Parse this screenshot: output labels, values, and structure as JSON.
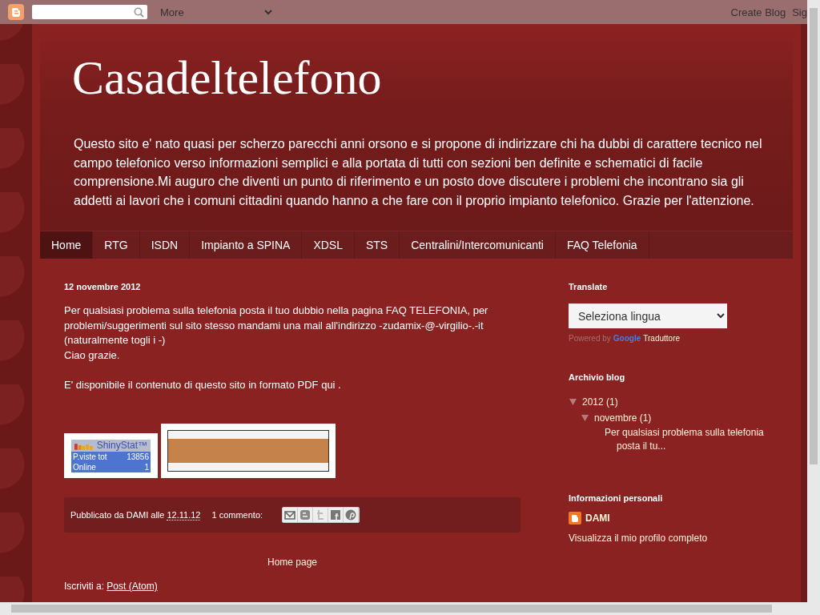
{
  "navbar": {
    "more": "More",
    "links": [
      "Create Blog",
      "Sig"
    ]
  },
  "header": {
    "title": "Casadeltelefono",
    "description": "Questo sito e' nato quasi per scherzo parecchi anni orsono e si propone di indirizzare chi ha dubbi di carattere tecnico nel campo telefonico verso informazioni semplici e alla portata di tutti con sezioni ben definite e schematici di facile comprensione.Mi auguro che diventi un punto di riferimento e un posto dove discutere i problemi che incontrano sia gli addetti ai lavori che i comuni cittadini quando hanno a che fare con il proprio impianto telefonico. Grazie per l'attenzione."
  },
  "tabs": [
    {
      "label": "Home",
      "selected": true
    },
    {
      "label": "RTG",
      "selected": false
    },
    {
      "label": "ISDN",
      "selected": false
    },
    {
      "label": "Impianto a SPINA",
      "selected": false
    },
    {
      "label": "XDSL",
      "selected": false
    },
    {
      "label": "STS",
      "selected": false
    },
    {
      "label": "Centralini/Intercomunicanti",
      "selected": false
    },
    {
      "label": "FAQ Telefonia",
      "selected": false
    }
  ],
  "post": {
    "date": "12 novembre 2012",
    "paragraphs": [
      "Per qualsiasi problema sulla telefonia posta il tuo dubbio nella pagina FAQ TELEFONIA, per problemi/suggerimenti sul sito stesso mandami una mail all'indirizzo -zudamix-@-virgilio-.-it (naturalmente togli i -)",
      "Ciao grazie.",
      "E' disponibile il contenuto di questo sito in formato PDF qui ."
    ],
    "counter": {
      "brand": "ShinyStat™",
      "rows": [
        {
          "label": "P.viste tot",
          "value": "13856"
        },
        {
          "label": "Online",
          "value": "1"
        }
      ]
    },
    "footer": {
      "posted_by": "Pubblicato da DAMI alle",
      "time": "12.11.12",
      "comments": "1 commento:"
    }
  },
  "home_link": "Home page",
  "subscribe": {
    "label": "Iscriviti a:",
    "link": "Post (Atom)"
  },
  "sidebar": {
    "translate": {
      "title": "Translate",
      "select": "Seleziona lingua",
      "powered": "Powered by",
      "brand": "Google",
      "product": "Traduttore"
    },
    "archive": {
      "title": "Archivio blog",
      "tree": [
        {
          "label": "2012",
          "count": "(1)",
          "expanded": true,
          "children": [
            {
              "label": "novembre",
              "count": "(1)",
              "expanded": true,
              "children": [
                {
                  "label": "Per qualsiasi problema sulla telefonia posta il tu..."
                }
              ]
            }
          ]
        }
      ]
    },
    "profile": {
      "title": "Informazioni personali",
      "name": "DAMI",
      "link": "Visualizza il mio profilo completo"
    }
  }
}
